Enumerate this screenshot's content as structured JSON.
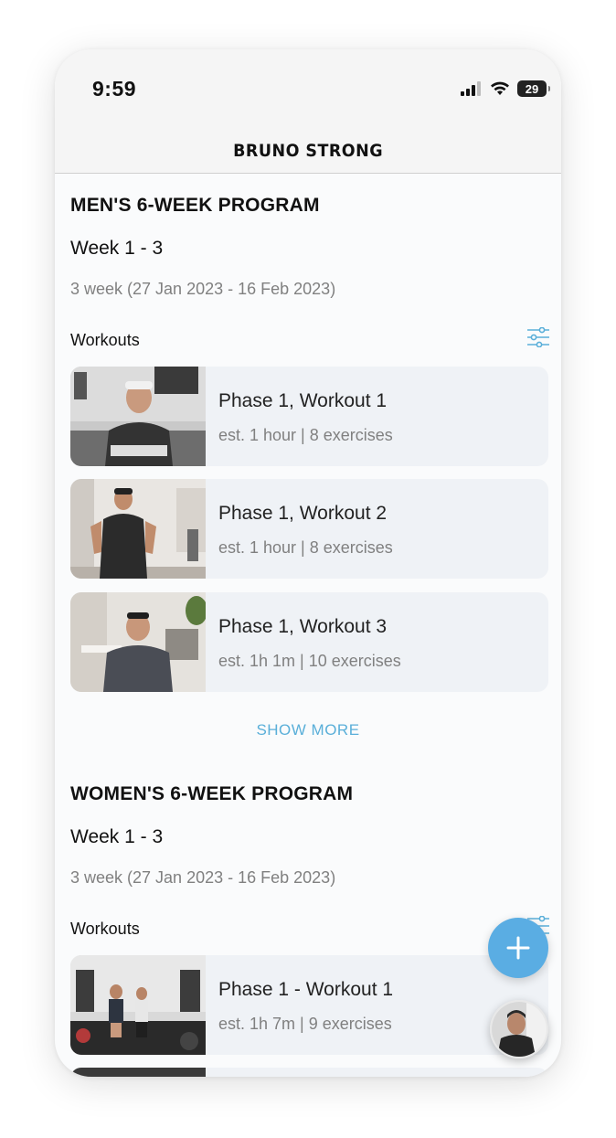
{
  "status_bar": {
    "time": "9:59",
    "battery": "29"
  },
  "nav": {
    "brand": "BRUNO STRONG"
  },
  "programs": [
    {
      "title": "MEN'S 6-WEEK PROGRAM",
      "week": "Week 1 - 3",
      "dates": "3 week (27 Jan 2023 - 16 Feb 2023)",
      "workouts_label": "Workouts",
      "workouts": [
        {
          "title": "Phase 1, Workout 1",
          "meta": "est. 1 hour | 8 exercises"
        },
        {
          "title": "Phase 1, Workout 2",
          "meta": "est. 1 hour | 8 exercises"
        },
        {
          "title": "Phase 1, Workout 3",
          "meta": "est. 1h 1m | 10 exercises"
        }
      ],
      "show_more": "SHOW MORE"
    },
    {
      "title": "WOMEN'S 6-WEEK PROGRAM",
      "week": "Week 1 - 3",
      "dates": "3 week (27 Jan 2023 - 16 Feb 2023)",
      "workouts_label": "Workouts",
      "workouts": [
        {
          "title": "Phase 1 - Workout 1",
          "meta": "est. 1h 7m | 9 exercises"
        }
      ]
    }
  ],
  "icons": {
    "filter": "sliders-icon",
    "fab": "plus-icon",
    "signal": "cellular-signal-icon",
    "wifi": "wifi-icon",
    "battery": "battery-icon"
  },
  "colors": {
    "accent": "#5aafd9",
    "card_bg": "#eff2f6",
    "muted_text": "#808080",
    "fab_bg": "#5aade3"
  }
}
